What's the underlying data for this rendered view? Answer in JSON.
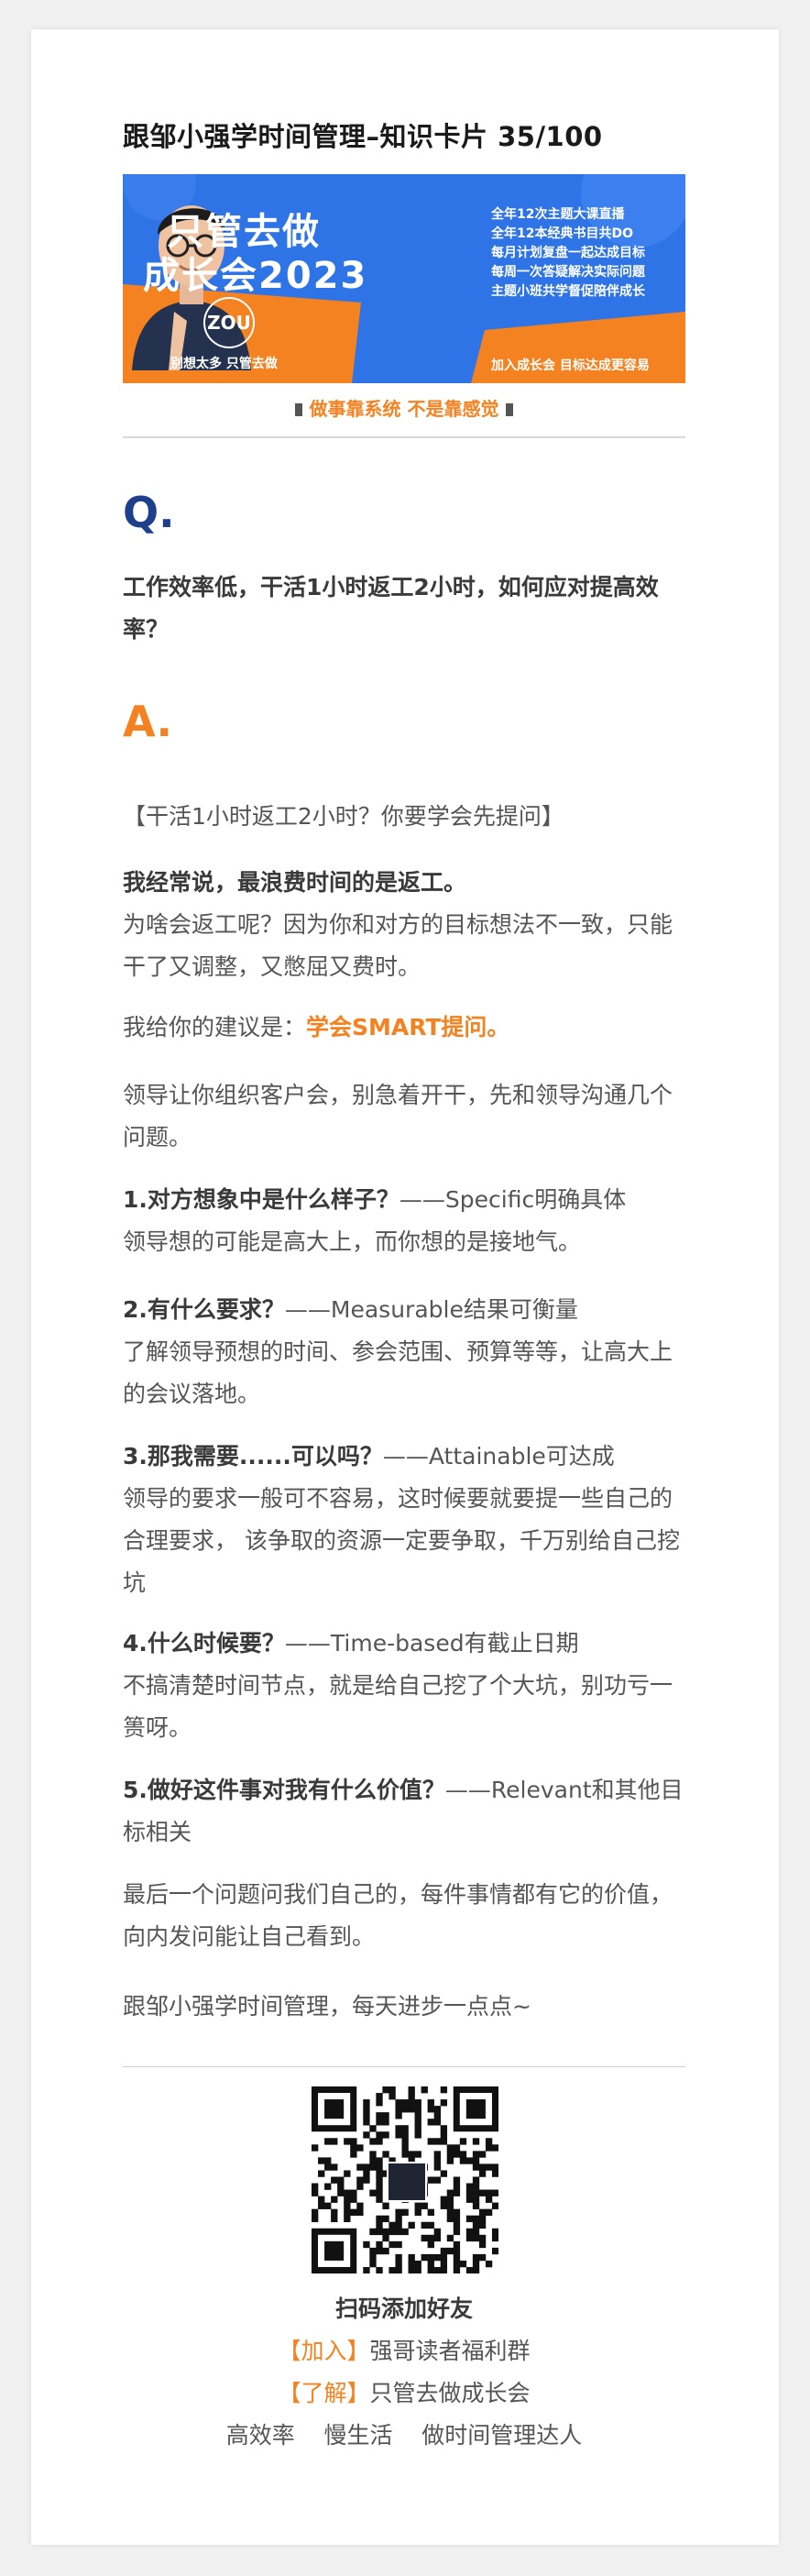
{
  "article": {
    "title": "跟邹小强学时间管理–知识卡片 35/100",
    "banner": {
      "title_line1": "只管去做",
      "title_line2": "成长会2023",
      "logo_text": "ZOU",
      "slogan_left": "别想太多 只管去做",
      "slogan_right": "加入成长会 目标达成更容易",
      "features": [
        "全年12次主题大课直播",
        "全年12本经典书目共DO",
        "每月计划复盘一起达成目标",
        "每周一次答疑解决实际问题",
        "主题小班共学督促陪伴成长"
      ],
      "colors": {
        "blue": "#2c6fe0",
        "orange": "#f58220"
      }
    },
    "tagline": "做事靠系统 不是靠感觉",
    "q_mark": "Q.",
    "question": "工作效率低，干活1小时返工2小时，如何应对提高效率？",
    "a_mark": "A.",
    "answer": {
      "intro": "【干活1小时返工2小时？你要学会先提问】",
      "p1_bold": "我经常说，最浪费时间的是返工。",
      "p1_text": "为啥会返工呢？因为你和对方的目标想法不一致，只能干了又调整，又憋屈又费时。",
      "p2_text": "我给你的建议是：",
      "p2_highlight": "学会SMART提问。",
      "p3_text": "领导让你组织客户会，别急着开干，先和领导沟通几个问题。",
      "points": [
        {
          "head": "1.对方想象中是什么样子？",
          "tail": "——Specific明确具体",
          "body": "领导想的可能是高大上，而你想的是接地气。"
        },
        {
          "head": "2.有什么要求？",
          "tail": "——Measurable结果可衡量",
          "body": "了解领导预想的时间、参会范围、预算等等，让高大上的会议落地。"
        },
        {
          "head": "3.那我需要......可以吗？",
          "tail": "——Attainable可达成",
          "body": "领导的要求一般可不容易，这时候要就要提一些自己的合理要求， 该争取的资源一定要争取，千万别给自己挖坑"
        },
        {
          "head": "4.什么时候要？",
          "tail": "——Time-based有截止日期",
          "body": "不搞清楚时间节点，就是给自己挖了个大坑，别功亏一篑呀。"
        },
        {
          "head": "5.做好这件事对我有什么价值？",
          "tail": "——Relevant和其他目标相关",
          "body": ""
        }
      ],
      "p_last": "最后一个问题问我们自己的，每件事情都有它的价值，向内发问能让自己看到。",
      "p_end": "跟邹小强学时间管理，每天进步一点点~"
    },
    "footer": {
      "qr_icon": "qr-code-icon",
      "scan_label": "扫码添加好友",
      "join_bracket": "【加入】",
      "join_text": "强哥读者福利群",
      "learn_bracket": "【了解】",
      "learn_text": "只管去做成长会",
      "motto": "高效率    慢生活    做时间管理达人"
    }
  }
}
